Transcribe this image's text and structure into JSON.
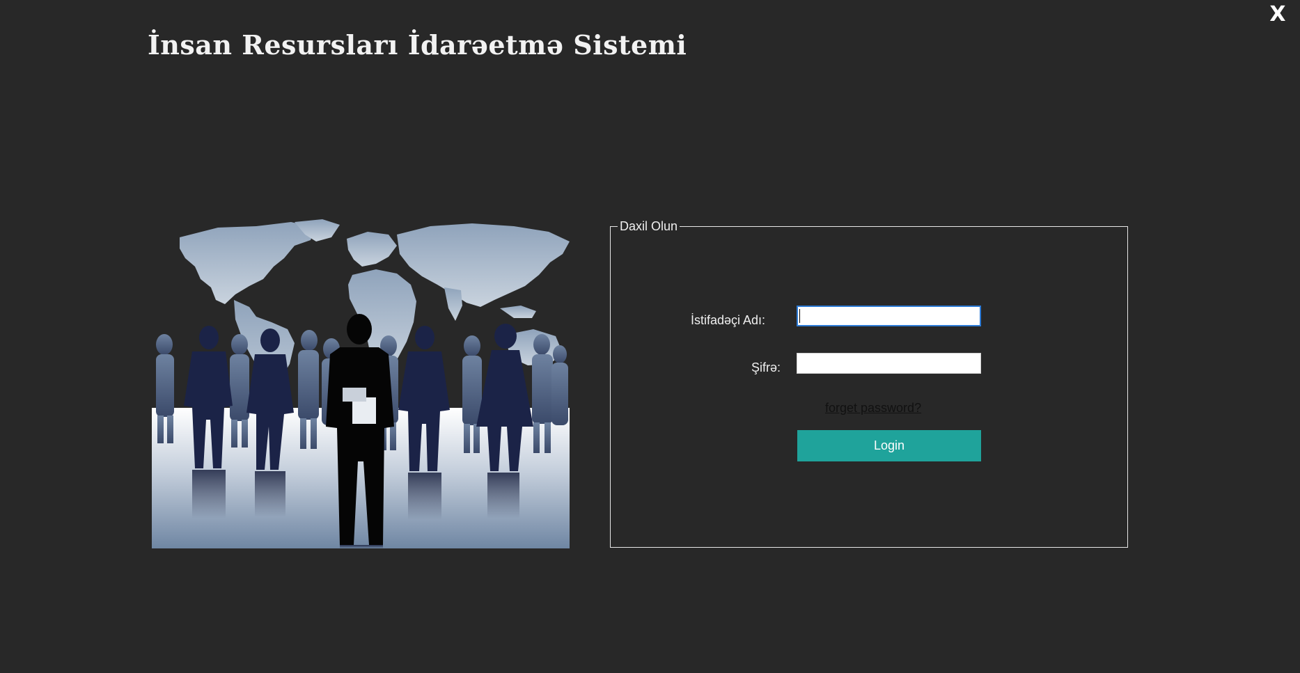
{
  "window": {
    "close_label": "X"
  },
  "header": {
    "title": "İnsan Resursları İdarəetmə Sistemi"
  },
  "login_group": {
    "legend": "Daxil Olun",
    "username_label": "İstifadəçi Adı:",
    "username_value": "",
    "password_label": "Şifrə:",
    "password_value": "",
    "forgot_link": "forget password?",
    "login_button": "Login"
  },
  "colors": {
    "background": "#282828",
    "accent": "#1fa39b",
    "focus_border": "#2d7bd6"
  }
}
